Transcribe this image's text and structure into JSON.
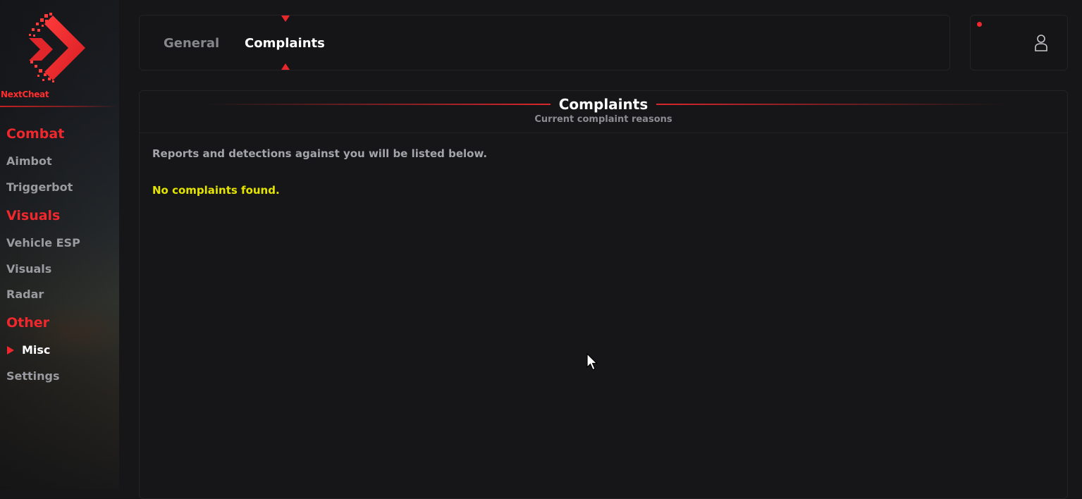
{
  "brand": {
    "name": "NextCheat",
    "accent": "#f0282d"
  },
  "sidebar": {
    "categories": [
      {
        "label": "Combat",
        "items": [
          {
            "label": "Aimbot"
          },
          {
            "label": "Triggerbot"
          }
        ]
      },
      {
        "label": "Visuals",
        "items": [
          {
            "label": "Vehicle ESP"
          },
          {
            "label": "Visuals"
          },
          {
            "label": "Radar"
          }
        ]
      },
      {
        "label": "Other",
        "items": [
          {
            "label": "Misc",
            "active": true
          },
          {
            "label": "Settings"
          }
        ]
      }
    ]
  },
  "tabs": [
    {
      "label": "General"
    },
    {
      "label": "Complaints",
      "active": true
    }
  ],
  "user": {
    "icon": "user-icon",
    "notification": true
  },
  "panel": {
    "title": "Complaints",
    "subtitle": "Current complaint reasons",
    "description": "Reports and detections against you will be listed below.",
    "empty_message": "No complaints found.",
    "empty_color": "#e4e400"
  }
}
